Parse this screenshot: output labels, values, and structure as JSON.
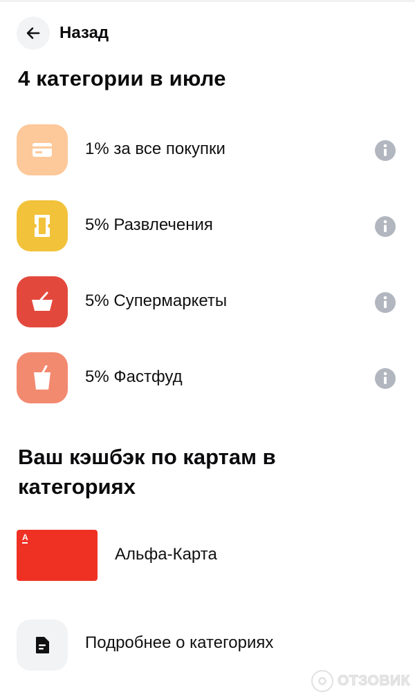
{
  "header": {
    "back_label": "Назад"
  },
  "title": "4 категории в июле",
  "categories": [
    {
      "label": "1% за все покупки",
      "color": "#fdc89a",
      "icon": "credit-card-icon"
    },
    {
      "label": "5% Развлечения",
      "color": "#f2c23a",
      "icon": "ticket-icon"
    },
    {
      "label": "5% Супермаркеты",
      "color": "#e3483d",
      "icon": "basket-icon"
    },
    {
      "label": "5% Фастфуд",
      "color": "#f28a70",
      "icon": "drink-cup-icon"
    }
  ],
  "section": {
    "title": "Ваш кэшбэк по картам в категориях"
  },
  "card": {
    "label": "Альфа-Карта",
    "logo": "A",
    "color": "#ef3124"
  },
  "more": {
    "label": "Подробнее о категориях"
  },
  "watermark": {
    "text": "ОТЗОВИК"
  }
}
